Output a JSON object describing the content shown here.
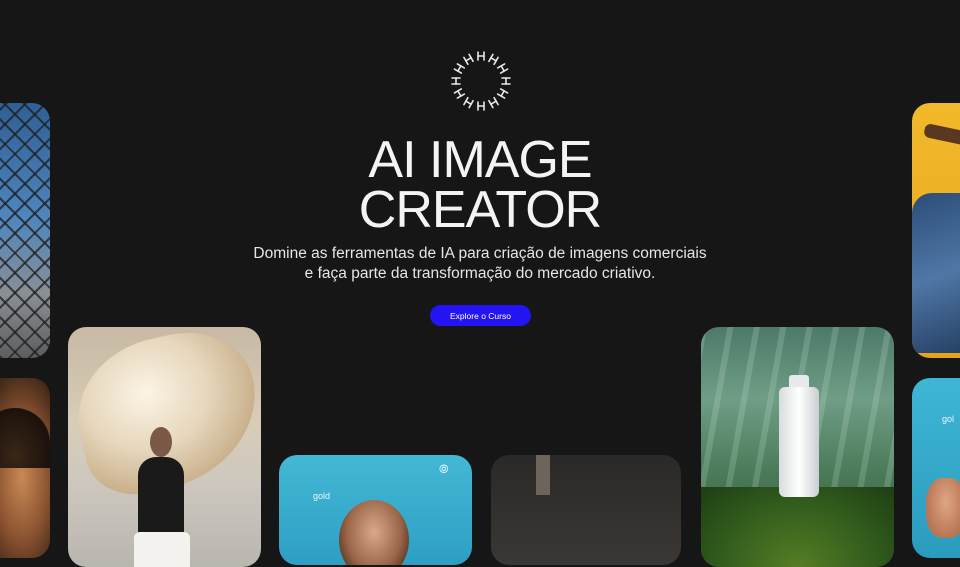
{
  "hero": {
    "logo_icon": "radial-letter-ring-icon",
    "title_line1": "AI IMAGE",
    "title_line2": "CREATOR",
    "subtitle_line1": "Domine as ferramentas de IA para criação de imagens comerciais",
    "subtitle_line2": "e faça parte da transformação do mercado criativo.",
    "cta_label": "Explore o Curso",
    "accent_color": "#2413f2"
  },
  "gallery": {
    "cards": [
      {
        "name": "chain-fence-photo"
      },
      {
        "name": "portrait-photo"
      },
      {
        "name": "silk-fabric-model-photo"
      },
      {
        "name": "gold-card-phone-photo",
        "label": "gold"
      },
      {
        "name": "dark-interior-photo"
      },
      {
        "name": "forest-bottle-photo"
      },
      {
        "name": "yellow-denim-photo"
      },
      {
        "name": "cyan-card-photo",
        "label": "gol"
      }
    ]
  }
}
